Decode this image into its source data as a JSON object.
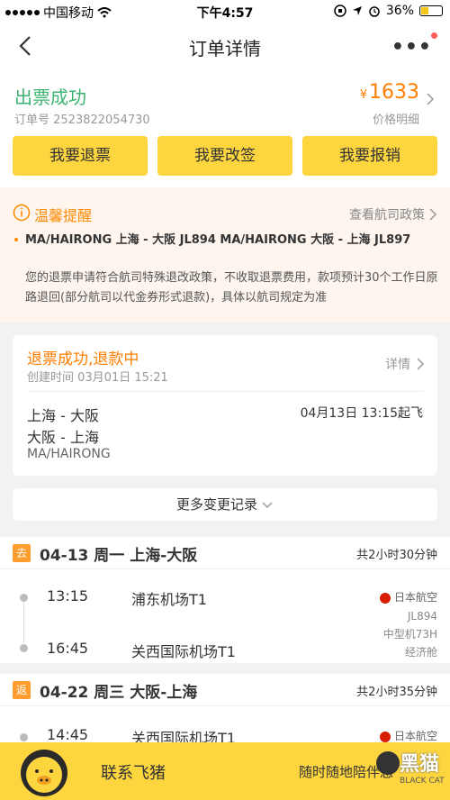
{
  "statusbar": {
    "carrier": "中国移动",
    "time": "下午4:57",
    "battery": "36%"
  },
  "navbar": {
    "title": "订单详情"
  },
  "summary": {
    "status": "出票成功",
    "order_no": "订单号 2523822054730",
    "price_symbol": "¥",
    "price": "1633",
    "price_detail": "价格明细",
    "buttons": [
      "我要退票",
      "我要改签",
      "我要报销"
    ]
  },
  "notice": {
    "title": "温馨提醒",
    "link": "查看航司政策",
    "route": "MA/HAIRONG 上海 - 大阪 JL894 MA/HAIRONG 大阪 - 上海 JL897",
    "body": "您的退票申请符合航司特殊退改政策，不收取退票费用，款项预计30个工作日原路退回(部分航司以代金券形式退款)，具体以航司规定为准"
  },
  "refund": {
    "title": "退票成功,退款中",
    "created": "创建时间 03月01日 15:21",
    "detail": "详情",
    "route1": "上海 - 大阪",
    "route2": "大阪 - 上海",
    "date": "04月13日 13:15起飞",
    "passenger": "MA/HAIRONG"
  },
  "more_records": "更多变更记录",
  "segments": [
    {
      "tag": "去",
      "route": "04-13 周一 上海-大阪",
      "duration": "共2小时30分钟",
      "dep_time": "13:15",
      "dep_airport": "浦东机场T1",
      "arr_time": "16:45",
      "arr_airport": "关西国际机场T1",
      "airline": "日本航空",
      "flight": "JL894",
      "aircraft": "中型机73H",
      "cabin": "经济舱"
    },
    {
      "tag": "返",
      "route": "04-22 周三 大阪-上海",
      "duration": "共2小时35分钟",
      "dep_time": "14:45",
      "dep_airport": "关西国际机场T1",
      "airline": "日本航空"
    }
  ],
  "bottom": {
    "contact": "联系飞猪",
    "anytime": "随时随地陪伴您",
    "watermark_cn": "黑猫",
    "watermark_en": "BLACK CAT"
  },
  "colors": {
    "accent": "#fcd53f",
    "success": "#3cb371",
    "price": "#ff7e00",
    "notice_bg": "#fdf5ee"
  }
}
